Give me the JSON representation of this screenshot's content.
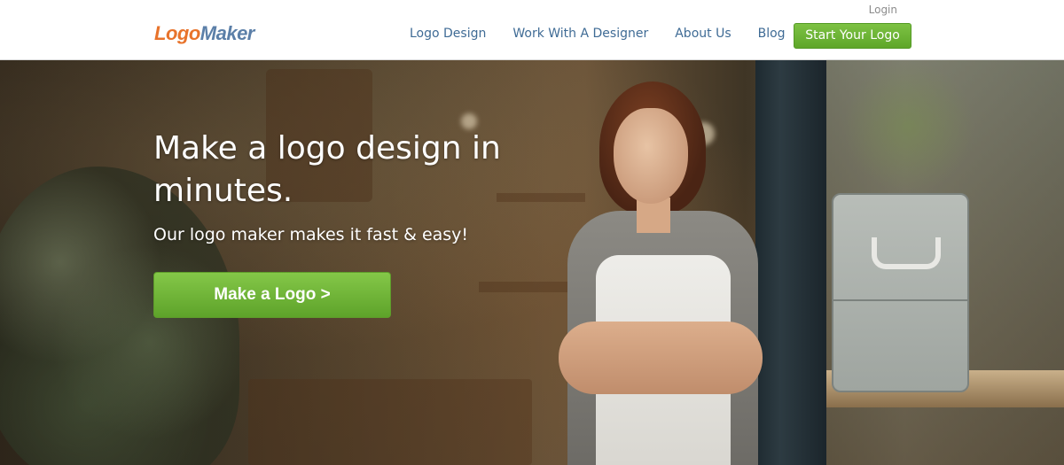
{
  "header": {
    "login": "Login",
    "logo": {
      "part1": "Logo",
      "part2": "Maker"
    },
    "nav": [
      {
        "label": "Logo Design"
      },
      {
        "label": "Work With A Designer"
      },
      {
        "label": "About Us"
      },
      {
        "label": "Blog"
      }
    ],
    "cta": "Start Your Logo"
  },
  "hero": {
    "title": "Make a logo design in minutes.",
    "subtitle": "Our logo maker makes it fast & easy!",
    "cta": "Make a Logo >"
  },
  "colors": {
    "logo_orange": "#e8732b",
    "logo_blue": "#5b7fa8",
    "nav_link": "#3f6b95",
    "cta_green": "#6fb538"
  }
}
